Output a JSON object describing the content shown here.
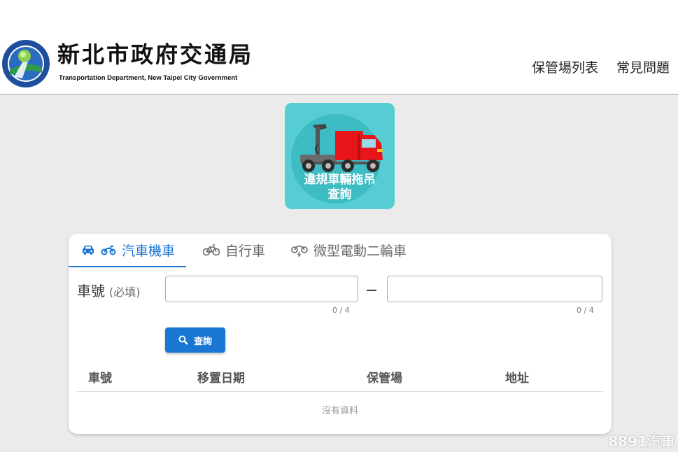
{
  "header": {
    "logo_title": "新北市政府交通局",
    "logo_subtitle": "Transportation Department, New Taipei City Government",
    "nav": [
      "保管場列表",
      "常見問題"
    ]
  },
  "tile": {
    "line1": "違規車輛拖吊",
    "line2": "查詢"
  },
  "tabs": [
    {
      "label": "汽車機車",
      "active": true
    },
    {
      "label": "自行車",
      "active": false
    },
    {
      "label": "微型電動二輪車",
      "active": false
    }
  ],
  "form": {
    "label": "車號",
    "required_hint": "(必填)",
    "input1_value": "",
    "input2_value": "",
    "counter1": "0 / 4",
    "counter2": "0 / 4",
    "search_button": "查詢"
  },
  "table": {
    "columns": [
      "車號",
      "移置日期",
      "保管場",
      "地址"
    ],
    "empty_text": "沒有資料"
  },
  "watermark": "8891汽車",
  "colors": {
    "primary": "#1976d2",
    "tile_bg": "#56cdd3",
    "truck_red": "#e8151b",
    "page_bg": "#ebebeb"
  }
}
